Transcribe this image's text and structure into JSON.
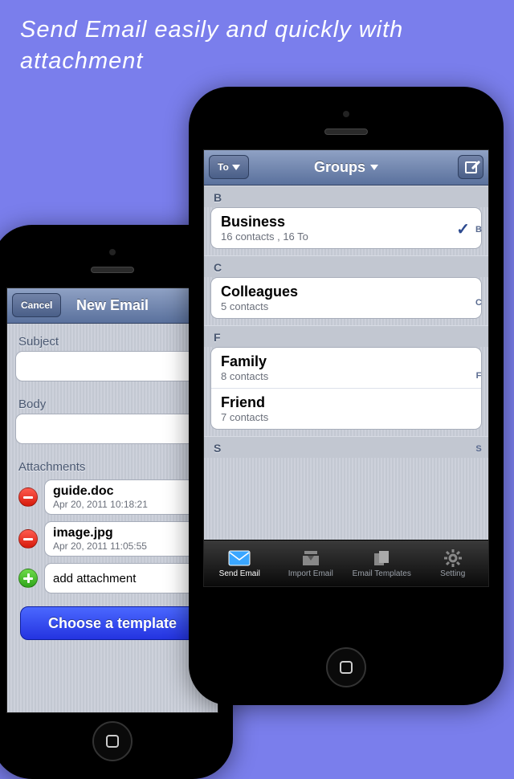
{
  "promo": {
    "headline": "Send Email easily and quickly with attachment"
  },
  "compose": {
    "cancel_label": "Cancel",
    "title": "New Email",
    "subject_label": "Subject",
    "body_label": "Body",
    "attachments_label": "Attachments",
    "attachments": [
      {
        "name": "guide.doc",
        "meta": "Apr 20, 2011 10:18:21"
      },
      {
        "name": "image.jpg",
        "meta": "Apr 20, 2011 11:05:55"
      }
    ],
    "add_attachment_label": "add attachment",
    "template_button_label": "Choose a template"
  },
  "groups": {
    "to_label": "To",
    "title": "Groups",
    "index": [
      "B",
      "C",
      "F",
      "S"
    ],
    "sections": [
      {
        "letter": "B",
        "items": [
          {
            "name": "Business",
            "sub": "16 contacts , 16 To",
            "checked": true
          }
        ]
      },
      {
        "letter": "C",
        "items": [
          {
            "name": "Colleagues",
            "sub": "5 contacts",
            "checked": false
          }
        ]
      },
      {
        "letter": "F",
        "items": [
          {
            "name": "Family",
            "sub": "8 contacts",
            "checked": false
          },
          {
            "name": "Friend",
            "sub": "7 contacts",
            "checked": false
          }
        ]
      },
      {
        "letter": "S",
        "items": []
      }
    ]
  },
  "tabs": {
    "items": [
      {
        "label": "Send Email",
        "active": true
      },
      {
        "label": "Import Email",
        "active": false
      },
      {
        "label": "Email Templates",
        "active": false
      },
      {
        "label": "Setting",
        "active": false
      }
    ]
  }
}
